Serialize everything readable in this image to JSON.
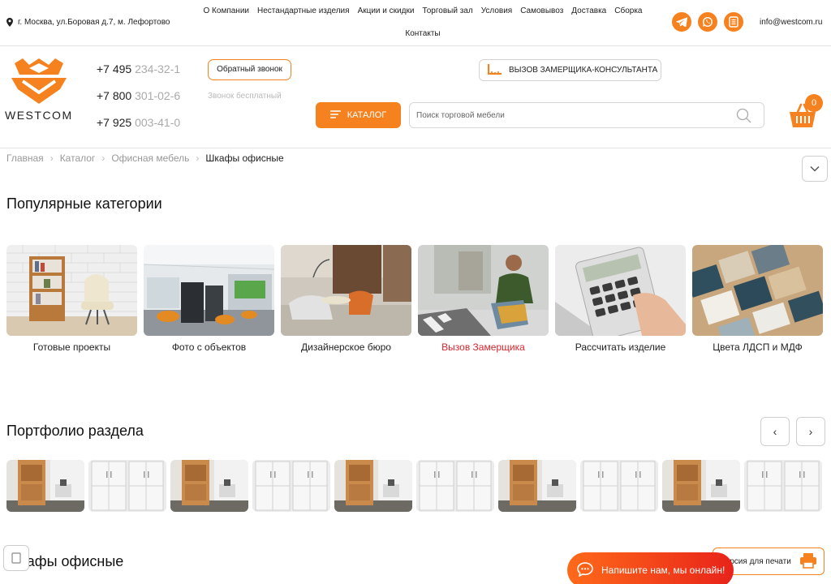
{
  "topbar": {
    "address": "г. Москва, ул.Боровая д.7, м. Лефортово",
    "nav": [
      "О Компании",
      "Нестандартные изделия",
      "Акции и скидки",
      "Торговый зал",
      "Условия",
      "Самовывоз",
      "Доставка",
      "Сборка",
      "Контакты"
    ],
    "email": "info@westcom.ru",
    "socials": [
      "telegram-icon",
      "whatsapp-icon",
      "document-icon"
    ]
  },
  "header": {
    "logo_text": "WESTCOM",
    "phones": [
      {
        "visible": "+7 495 ",
        "faded": "234-32-1"
      },
      {
        "visible": "+7 800 ",
        "faded": "301-02-6"
      },
      {
        "visible": "+7 925 ",
        "faded": "003-41-0"
      }
    ],
    "callback_label": "Обратный звонок",
    "free_call_label": "Звонок бесплатный",
    "measure_label": "Вызов замерщика-консультанта",
    "catalog_label": "Каталог",
    "search_placeholder": "Поиск торговой мебели",
    "cart_count": "0"
  },
  "breadcrumb": {
    "items": [
      "Главная",
      "Каталог",
      "Офисная мебель"
    ],
    "current": "Шкафы офисные"
  },
  "popular": {
    "title": "Популярные категории",
    "items": [
      {
        "label": "Готовые проекты",
        "highlight": false
      },
      {
        "label": "Фото с объектов",
        "highlight": false
      },
      {
        "label": "Дизайнерское бюро",
        "highlight": false
      },
      {
        "label": "Вызов Замерщика",
        "highlight": true
      },
      {
        "label": "Рассчитать изделие",
        "highlight": false
      },
      {
        "label": "Цвета ЛДСП и МДФ",
        "highlight": false
      }
    ]
  },
  "portfolio": {
    "title": "Портфолио раздела",
    "prev": "‹",
    "next": "›",
    "thumbs": [
      "wood",
      "white",
      "wood",
      "white",
      "wood",
      "white",
      "wood",
      "white",
      "wood",
      "white"
    ]
  },
  "bottom": {
    "section_title": "Шкафы офисные",
    "print_label": "Версия для печати",
    "chat_label": "Напишите нам, мы онлайн!"
  },
  "colors": {
    "accent": "#f5821f",
    "highlight_red": "#d9242b",
    "chat_gradient_start": "#ff6a1a",
    "chat_gradient_end": "#e8231a"
  }
}
